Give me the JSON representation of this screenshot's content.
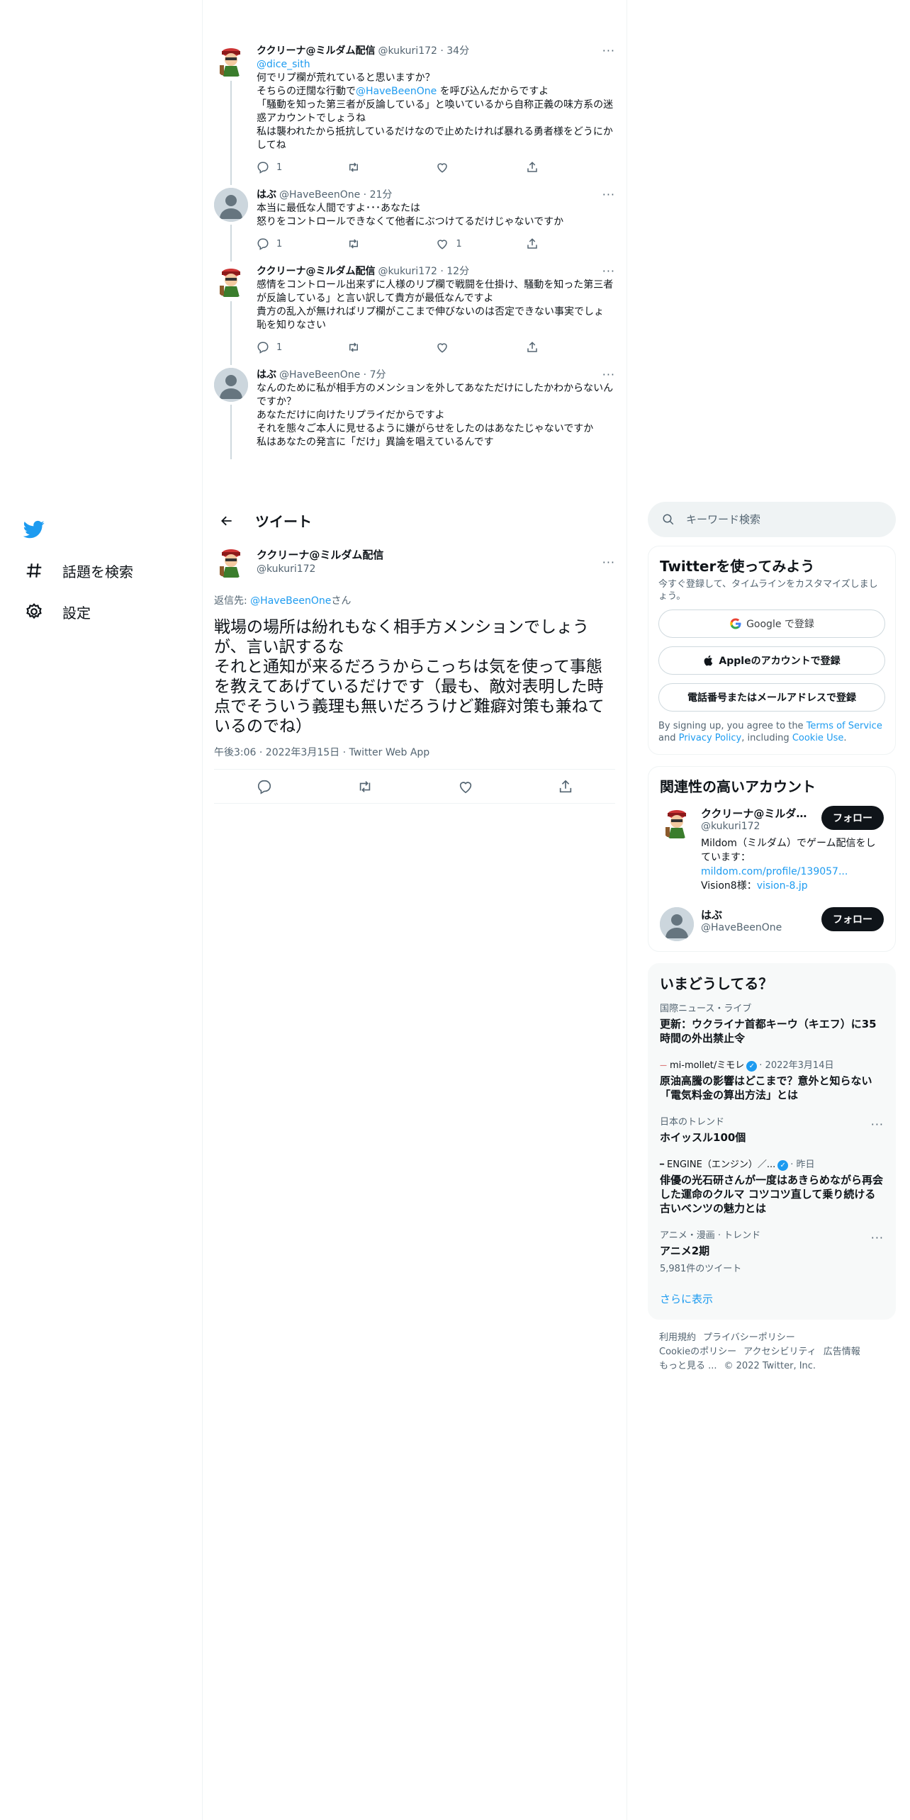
{
  "thread": [
    {
      "name": "ククリーナ@ミルダム配信",
      "meta": "@kukuri172 · 34分",
      "reply_to": "@dice_sith",
      "text_parts": [
        "何でリプ欄が荒れていると思いますか？\nそちらの迂闊な行動で",
        "@HaveBeenOne",
        " を呼び込んだからですよ\n「騒動を知った第三者が反論している」と喚いているから自称正義の味方系の迷惑アカウントでしょうね\n私は襲われたから抵抗しているだけなので止めたければ暴れる勇者様をどうにかしてね"
      ],
      "reply_count": "1",
      "retweet_count": "",
      "like_count": ""
    },
    {
      "name": "はぶ",
      "meta": "@HaveBeenOne · 21分",
      "text": "本当に最低な人間ですよ･･･あなたは\n怒りをコントロールできなくて他者にぶつけてるだけじゃないですか",
      "reply_count": "1",
      "retweet_count": "",
      "like_count": "1"
    },
    {
      "name": "ククリーナ@ミルダム配信",
      "meta": "@kukuri172 · 12分",
      "text": "感情をコントロール出来ずに人様のリプ欄で戦闘を仕掛け、騒動を知った第三者が反論している」と言い訳して貴方が最低なんですよ\n貴方の乱入が無ければリプ欄がここまで伸びないのは否定できない事実でしょ\n恥を知りなさい",
      "reply_count": "1",
      "retweet_count": "",
      "like_count": ""
    },
    {
      "name": "はぶ",
      "meta": "@HaveBeenOne · 7分",
      "text": "なんのために私が相手方のメンションを外してあなただけにしたかわからないんですか？\nあなただけに向けたリプライだからですよ\nそれを態々ご本人に見せるように嫌がらせをしたのはあなたじゃないですか\n私はあなたの発言に「だけ」異論を唱えているんです"
    }
  ],
  "nav": {
    "explore_label": "話題を検索",
    "settings_label": "設定"
  },
  "header": {
    "title": "ツイート"
  },
  "main_tweet": {
    "name": "ククリーナ@ミルダム配信",
    "handle": "@kukuri172",
    "replying_prefix": "返信先: ",
    "replying_to": "@HaveBeenOne",
    "replying_suffix": "さん",
    "text": "戦場の場所は紛れもなく相手方メンションでしょうが、言い訳するな\nそれと通知が来るだろうからこっちは気を使って事態を教えてあげているだけです（最も、敵対表明した時点でそういう義理も無いだろうけど難癖対策も兼ねているのでね）",
    "timestamp": "午後3:06 · 2022年3月15日 · Twitter Web App"
  },
  "search": {
    "placeholder": "キーワード検索"
  },
  "signup": {
    "title": "Twitterを使ってみよう",
    "subtitle": "今すぐ登録して、タイムラインをカスタマイズしましょう。",
    "google_label": "Google で登録",
    "apple_label": "Appleのアカウントで登録",
    "phone_label": "電話番号またはメールアドレスで登録",
    "terms_prefix": "By signing up, you agree to the ",
    "terms_link": "Terms of Service",
    "terms_and": " and ",
    "privacy_link": "Privacy Policy",
    "terms_including": ", including ",
    "cookie_link": "Cookie Use",
    "terms_end": "."
  },
  "relevant": {
    "title": "関連性の高いアカウント",
    "accounts": [
      {
        "name": "ククリーナ@ミルダ...",
        "handle": "@kukuri172",
        "bio_prefix": "Mildom（ミルダム）でゲーム配信をしています：",
        "bio_link": "mildom.com/profile/139057...",
        "bio_line2_prefix": "Vision8様：",
        "bio_link2": "vision-8.jp",
        "follow_label": "フォロー"
      },
      {
        "name": "はぶ",
        "handle": "@HaveBeenOne",
        "follow_label": "フォロー"
      }
    ]
  },
  "trends": {
    "title": "いまどうしてる？",
    "items": [
      {
        "context": "国際ニュース・ライブ",
        "title": "更新：ウクライナ首都キーウ（キエフ）に35時間の外出禁止令"
      },
      {
        "context_source": "mi-mollet/ミモレ",
        "context_time": "· 2022年3月14日",
        "title": "原油高騰の影響はどこまで？意外と知らない「電気料金の算出方法」とは"
      },
      {
        "context": "日本のトレンド",
        "title": "ホイッスル100個"
      },
      {
        "context_source": "ENGINE（エンジン）／...",
        "context_time": "· 昨日",
        "title": "俳優の光石研さんが一度はあきらめながら再会した運命のクルマ コツコツ直して乗り続ける古いベンツの魅力とは"
      },
      {
        "context": "アニメ・漫画 · トレンド",
        "title": "アニメ2期",
        "count": "5,981件のツイート"
      }
    ],
    "show_more": "さらに表示"
  },
  "footer": {
    "links": [
      "利用規約",
      "プライバシーポリシー",
      "Cookieのポリシー",
      "アクセシビリティ",
      "広告情報",
      "もっと見る ..."
    ],
    "copyright": "© 2022 Twitter, Inc."
  },
  "colors": {
    "accent": "#1d9bf0",
    "text": "#0f1419",
    "secondary": "#536471",
    "follow_bg": "#0f1419"
  }
}
